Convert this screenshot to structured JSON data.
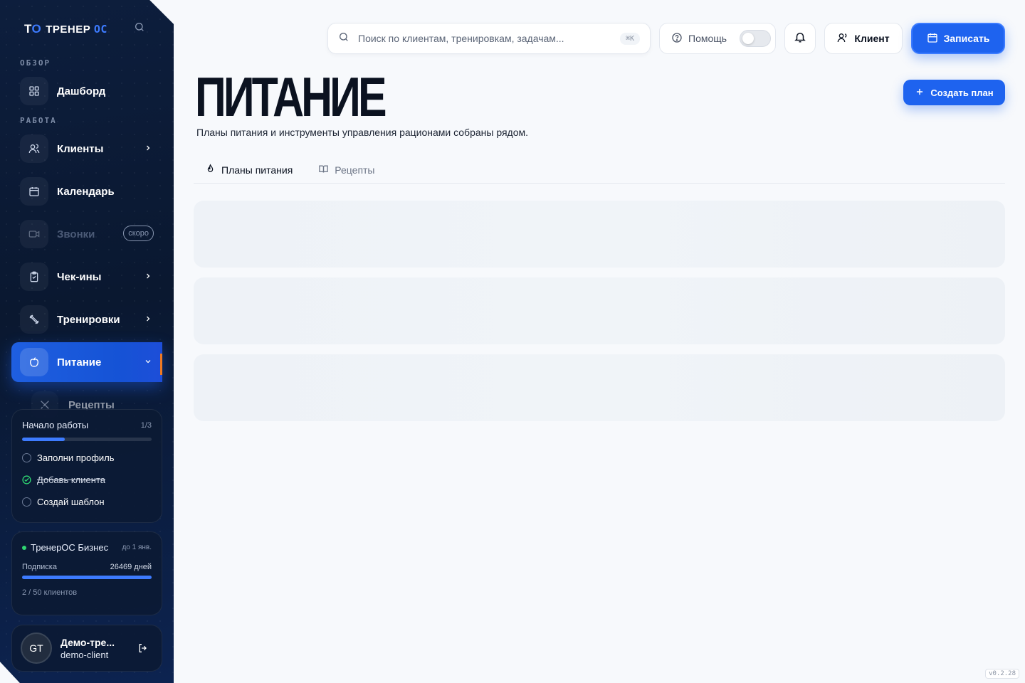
{
  "app": {
    "logo_mark": "Т",
    "logo_mark_accent": "О",
    "logo_text": "ТРЕНЕР",
    "logo_text_accent": "ОС",
    "version": "v0.2.28"
  },
  "sidebar": {
    "sections": {
      "overview": "ОБЗОР",
      "work": "РАБОТА"
    },
    "items": {
      "dashboard": {
        "label": "Дашборд",
        "icon": "grid-icon"
      },
      "clients": {
        "label": "Клиенты",
        "icon": "users-icon"
      },
      "calendar": {
        "label": "Календарь",
        "icon": "calendar-icon"
      },
      "calls": {
        "label": "Звонки",
        "icon": "video-icon",
        "badge": "скоро"
      },
      "checkins": {
        "label": "Чек-ины",
        "icon": "clipboard-icon"
      },
      "workouts": {
        "label": "Тренировки",
        "icon": "dumbbell-icon"
      },
      "nutrition": {
        "label": "Питание",
        "icon": "apple-icon"
      },
      "recipes": {
        "label": "Рецепты",
        "icon": "utensils-icon"
      }
    },
    "onboarding": {
      "title": "Начало работы",
      "count": "1/3",
      "progress": 0.33,
      "tasks": [
        {
          "label": "Заполни профиль",
          "done": false
        },
        {
          "label": "Добавь клиента",
          "done": true
        },
        {
          "label": "Создай шаблон",
          "done": false
        }
      ]
    },
    "plan": {
      "name": "ТренерОС Бизнес",
      "until": "до 1 янв.",
      "subscription_label": "Подписка",
      "days": "26469 дней",
      "progress": 1.0,
      "clients": "2 / 50 клиентов"
    },
    "user": {
      "initials": "GT",
      "name": "Демо-тре...",
      "sub": "demo-client"
    }
  },
  "topbar": {
    "search_placeholder": "Поиск по клиентам, тренировкам, задачам...",
    "search_kbd": "⌘K",
    "help_label": "Помощь",
    "client_label": "Клиент",
    "record_label": "Записать"
  },
  "main": {
    "title": "ПИТАНИЕ",
    "subtitle": "Планы питания и инструменты управления рационами собраны рядом.",
    "create_label": "Создать план",
    "tabs": [
      {
        "label": "Планы питания",
        "active": true
      },
      {
        "label": "Рецепты",
        "active": false
      }
    ]
  },
  "colors": {
    "accent": "#1e63ef",
    "sidebar_bg": "#0b1a35",
    "active_marker": "#f07a22",
    "status_green": "#2fd672"
  }
}
